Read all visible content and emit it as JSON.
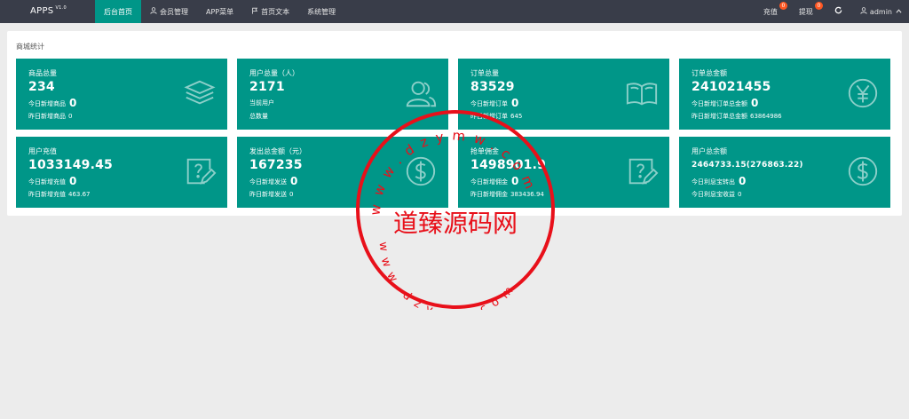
{
  "topbar": {
    "brand": "APPS",
    "version": "V1.0",
    "nav": [
      {
        "label": "后台首页",
        "active": true,
        "icon": ""
      },
      {
        "label": "会员管理",
        "active": false,
        "icon": "user-icon"
      },
      {
        "label": "APP菜单",
        "active": false,
        "icon": ""
      },
      {
        "label": "首页文本",
        "active": false,
        "icon": "flag-icon"
      },
      {
        "label": "系统管理",
        "active": false,
        "icon": ""
      }
    ],
    "recharge": {
      "label": "充值",
      "badge": "0"
    },
    "withdraw": {
      "label": "提现",
      "badge": "0"
    },
    "user": "admin"
  },
  "panel": {
    "title": "商城统计"
  },
  "cards": [
    {
      "title": "商品总量",
      "value": "234",
      "line1_label": "今日新增商品",
      "line1_value": "0",
      "line2_label": "昨日新增商品",
      "line2_value": "0",
      "icon": "stack-icon"
    },
    {
      "title": "用户总量（人）",
      "value": "2171",
      "line1_label": "当前用户",
      "line1_value": "",
      "line2_label": "总数量",
      "line2_value": "",
      "icon": "users-icon"
    },
    {
      "title": "订单总量",
      "value": "83529",
      "line1_label": "今日新增订单",
      "line1_value": "0",
      "line2_label": "昨日新增订单",
      "line2_value": "645",
      "icon": "book-icon"
    },
    {
      "title": "订单总金额",
      "value": "241021455",
      "line1_label": "今日新增订单总金额",
      "line1_value": "0",
      "line2_label": "昨日新增订单总金额",
      "line2_value": "63864986",
      "icon": "yen-icon"
    },
    {
      "title": "用户充值",
      "value": "1033149.45",
      "line1_label": "今日新增充值",
      "line1_value": "0",
      "line2_label": "昨日新增充值",
      "line2_value": "463.67",
      "icon": "edit-icon"
    },
    {
      "title": "发出总金额（元）",
      "value": "167235",
      "line1_label": "今日新增发送",
      "line1_value": "0",
      "line2_label": "昨日新增发送",
      "line2_value": "0",
      "icon": "dollar-icon"
    },
    {
      "title": "抢单佣金",
      "value": "1498901.9",
      "line1_label": "今日新增佣金",
      "line1_value": "0",
      "line2_label": "昨日新增佣金",
      "line2_value": "383436.94",
      "icon": "edit-icon"
    },
    {
      "title": "用户总余额",
      "value": "2464733.15(276863.22)",
      "line1_label": "今日利息宝转出",
      "line1_value": "0",
      "line2_label": "今日利息宝收益",
      "line2_value": "0",
      "icon": "dollar-icon"
    }
  ],
  "watermark": {
    "text": "道臻源码网",
    "url_top": "www.dzymw.com",
    "url_bottom": "www.dzymw.com",
    "color": "#e8101a"
  },
  "colors": {
    "accent": "#009688",
    "topbar": "#393d49",
    "badge": "#ff5722"
  }
}
